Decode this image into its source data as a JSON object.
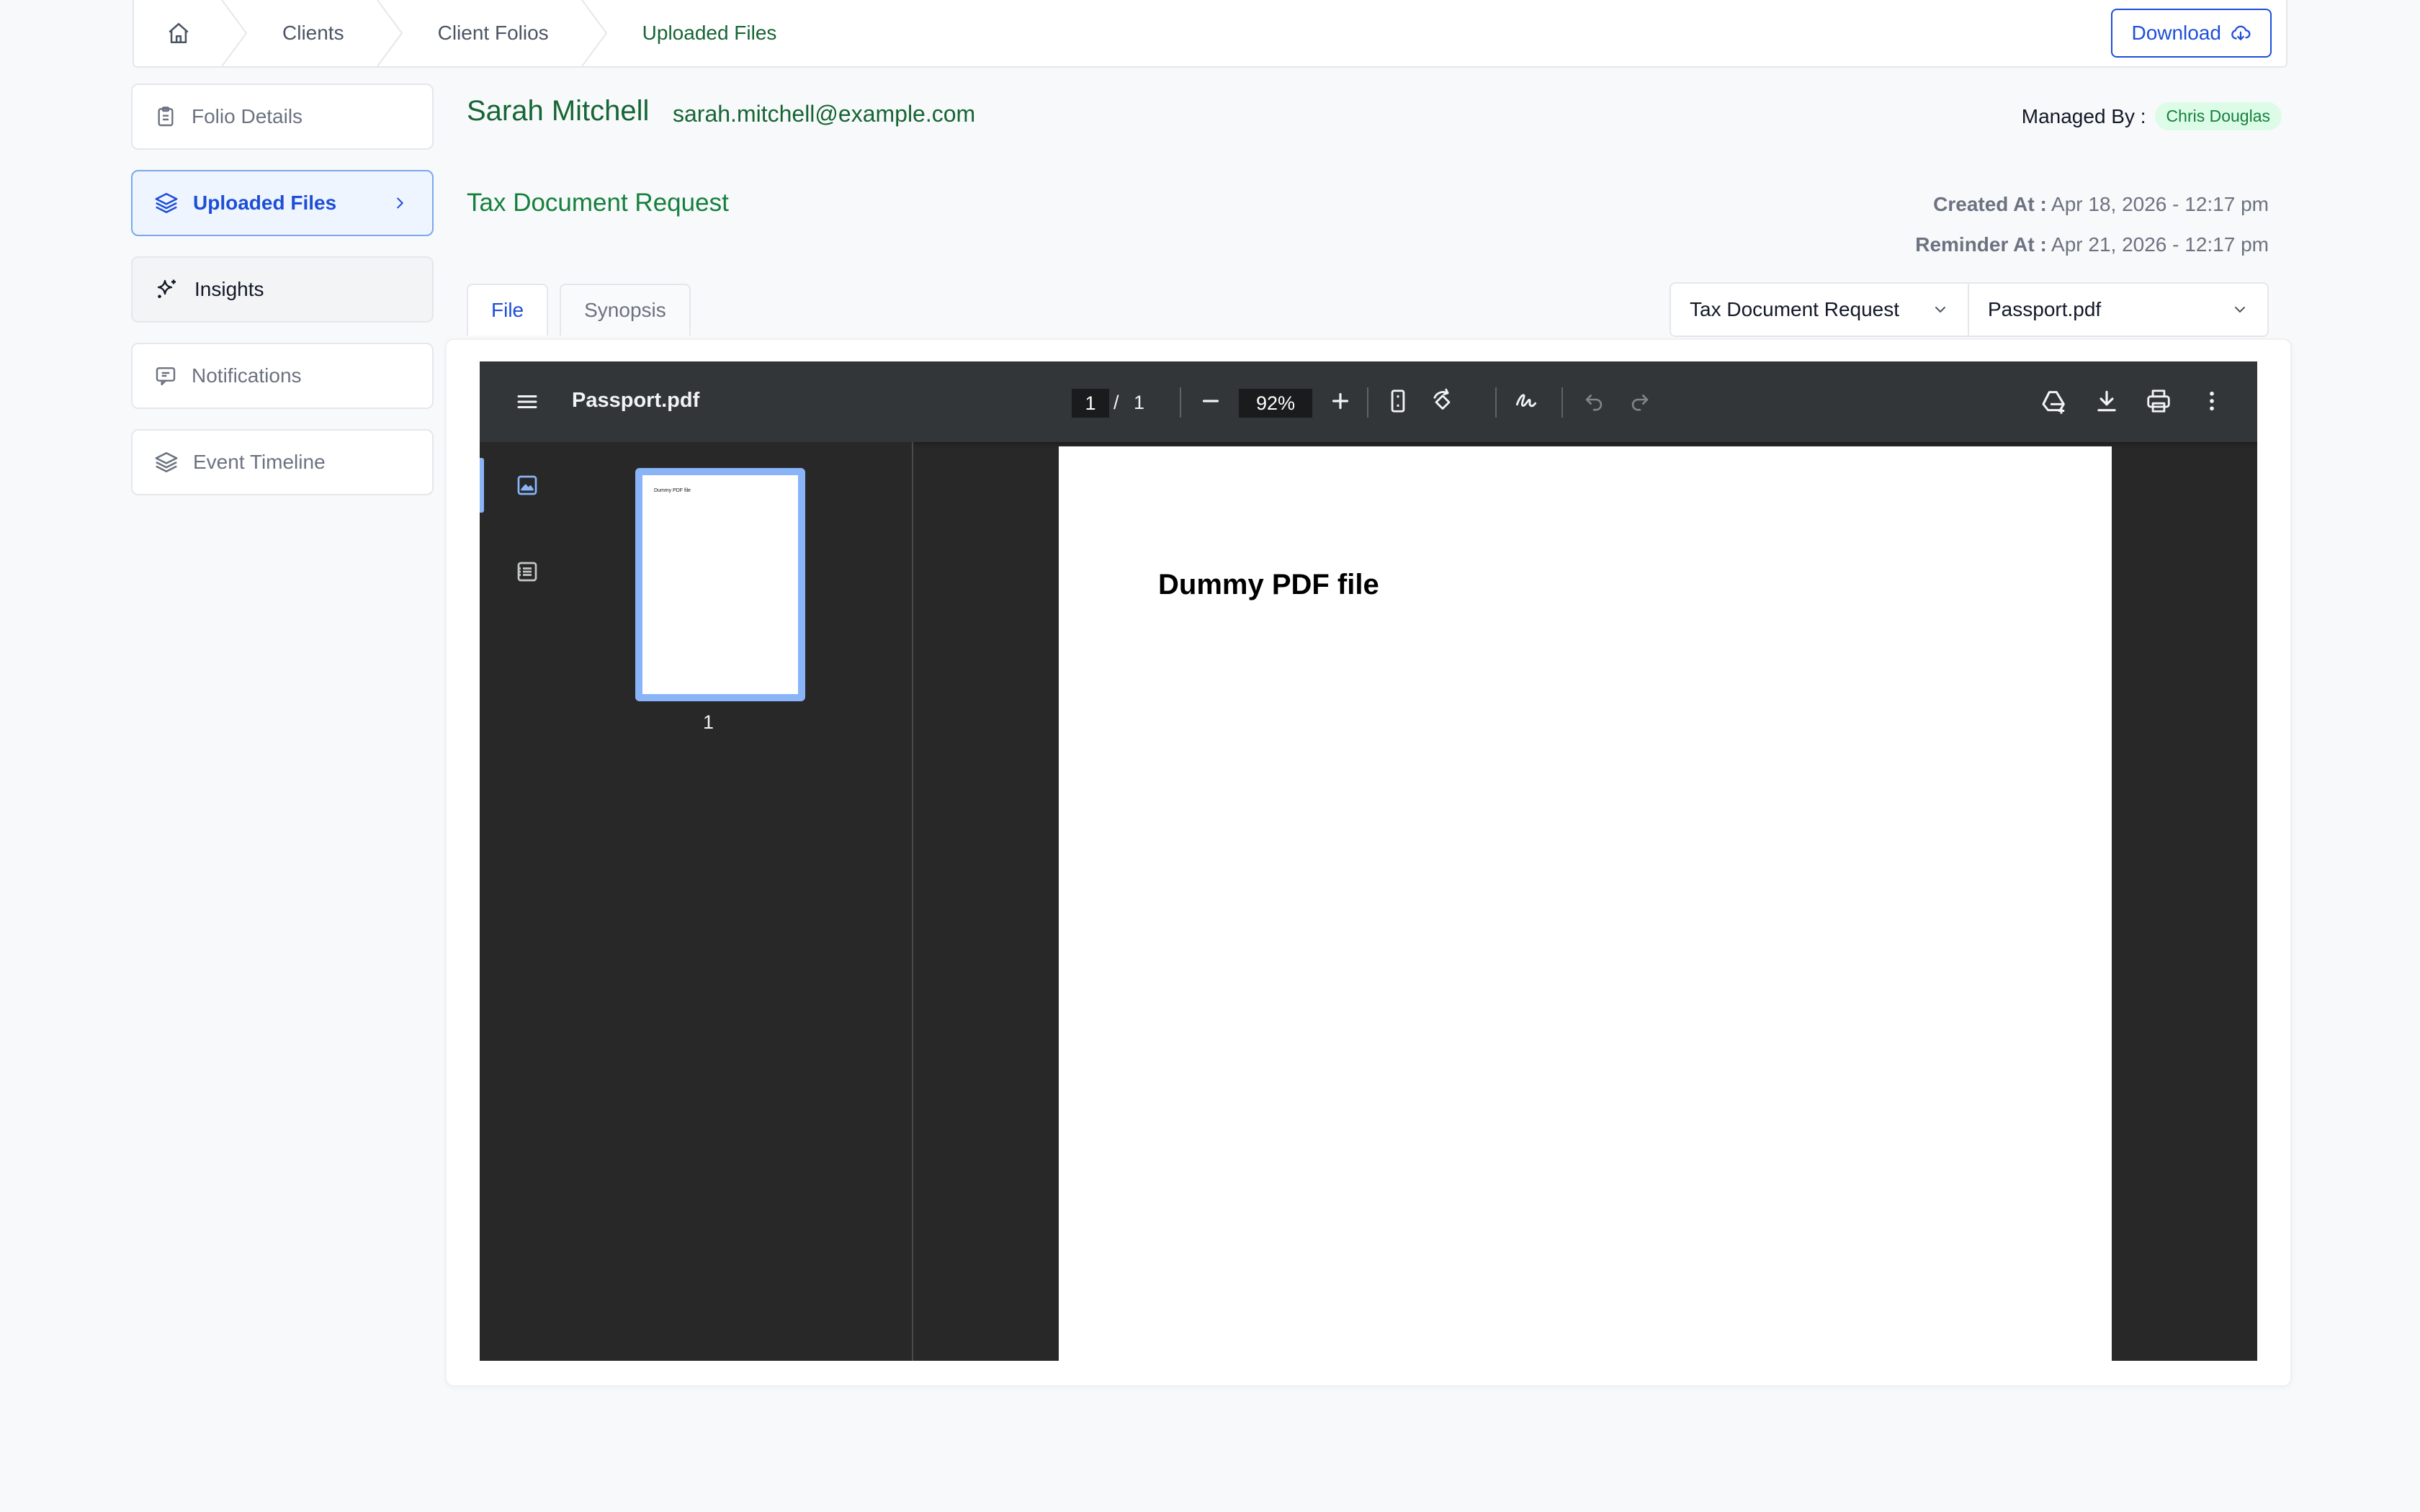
{
  "breadcrumb": {
    "items": [
      {
        "label": "Clients"
      },
      {
        "label": "Client Folios"
      },
      {
        "label": "Uploaded Files"
      }
    ],
    "download_label": "Download"
  },
  "sidebar": {
    "items": [
      {
        "label": "Folio Details",
        "icon": "clipboard-icon"
      },
      {
        "label": "Uploaded Files",
        "icon": "layers-icon",
        "active": true
      },
      {
        "label": "Insights",
        "icon": "sparkle-icon"
      },
      {
        "label": "Notifications",
        "icon": "message-icon"
      },
      {
        "label": "Event Timeline",
        "icon": "layers-icon"
      }
    ]
  },
  "client": {
    "name": "Sarah Mitchell",
    "email": "sarah.mitchell@example.com",
    "managed_by_label": "Managed By :",
    "managed_by": "Chris Douglas"
  },
  "request": {
    "title": "Tax Document Request",
    "created_label": "Created At :",
    "created_value": "Apr 18, 2026 - 12:17 pm",
    "reminder_label": "Reminder At :",
    "reminder_value": "Apr 21, 2026 - 12:17 pm"
  },
  "tabs": [
    {
      "label": "File",
      "active": true
    },
    {
      "label": "Synopsis"
    }
  ],
  "selects": {
    "request": "Tax Document Request",
    "file": "Passport.pdf"
  },
  "viewer": {
    "filename": "Passport.pdf",
    "page_current": "1",
    "page_sep": "/",
    "page_total": "1",
    "zoom": "92%",
    "thumb_number": "1",
    "thumb_text": "Dummy PDF file",
    "pdf_heading": "Dummy PDF file"
  },
  "colors": {
    "accent_green": "#166534",
    "accent_blue": "#1d4ed8",
    "viewer_bg": "#282828",
    "viewer_toolbar": "#323639"
  }
}
